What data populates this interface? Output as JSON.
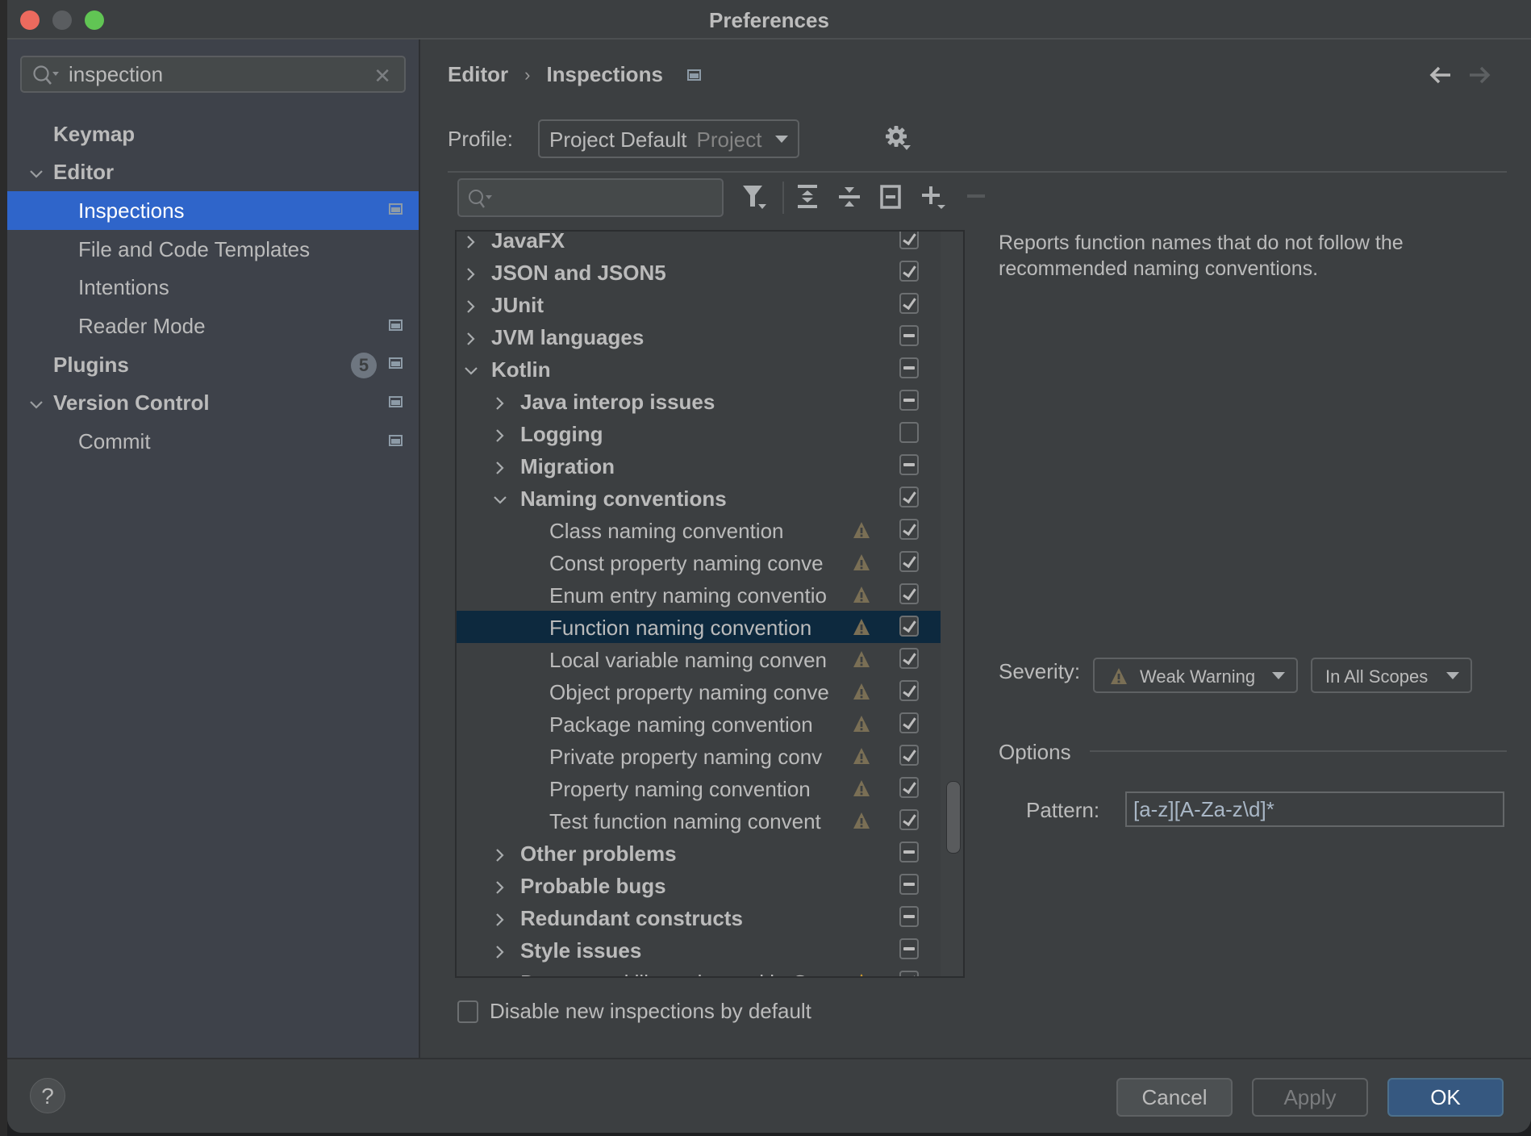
{
  "window": {
    "title": "Preferences"
  },
  "sidebar": {
    "search_value": "inspection",
    "items": [
      {
        "label": "Keymap",
        "level": 0,
        "bold": true,
        "expander": "none",
        "selected": false,
        "project_icon": false
      },
      {
        "label": "Editor",
        "level": 0,
        "bold": true,
        "expander": "expanded",
        "selected": false,
        "project_icon": false
      },
      {
        "label": "Inspections",
        "level": 1,
        "bold": false,
        "expander": "none",
        "selected": true,
        "project_icon": true
      },
      {
        "label": "File and Code Templates",
        "level": 1,
        "bold": false,
        "expander": "none",
        "selected": false,
        "project_icon": false
      },
      {
        "label": "Intentions",
        "level": 1,
        "bold": false,
        "expander": "none",
        "selected": false,
        "project_icon": false
      },
      {
        "label": "Reader Mode",
        "level": 1,
        "bold": false,
        "expander": "none",
        "selected": false,
        "project_icon": true
      },
      {
        "label": "Plugins",
        "level": 0,
        "bold": true,
        "expander": "none",
        "selected": false,
        "project_icon": true,
        "badge": "5"
      },
      {
        "label": "Version Control",
        "level": 0,
        "bold": true,
        "expander": "expanded",
        "selected": false,
        "project_icon": true
      },
      {
        "label": "Commit",
        "level": 1,
        "bold": false,
        "expander": "none",
        "selected": false,
        "project_icon": true
      }
    ]
  },
  "header": {
    "breadcrumb": [
      "Editor",
      "Inspections"
    ],
    "back_icon": "arrow-left-icon",
    "forward_icon": "arrow-right-icon"
  },
  "profile": {
    "label": "Profile:",
    "value": "Project Default",
    "scope": "Project"
  },
  "tree": {
    "search_value": "",
    "rows": [
      {
        "label": "JavaFX",
        "level": 0,
        "bold": true,
        "expander": "collapsed",
        "state": "checked",
        "warning": false
      },
      {
        "label": "JSON and JSON5",
        "level": 0,
        "bold": true,
        "expander": "collapsed",
        "state": "checked",
        "warning": false
      },
      {
        "label": "JUnit",
        "level": 0,
        "bold": true,
        "expander": "collapsed",
        "state": "checked",
        "warning": false
      },
      {
        "label": "JVM languages",
        "level": 0,
        "bold": true,
        "expander": "collapsed",
        "state": "partial",
        "warning": false
      },
      {
        "label": "Kotlin",
        "level": 0,
        "bold": true,
        "expander": "expanded",
        "state": "partial",
        "warning": false
      },
      {
        "label": "Java interop issues",
        "level": 1,
        "bold": true,
        "expander": "collapsed",
        "state": "partial",
        "warning": false
      },
      {
        "label": "Logging",
        "level": 1,
        "bold": true,
        "expander": "collapsed",
        "state": "unchecked",
        "warning": false
      },
      {
        "label": "Migration",
        "level": 1,
        "bold": true,
        "expander": "collapsed",
        "state": "partial",
        "warning": false
      },
      {
        "label": "Naming conventions",
        "level": 1,
        "bold": true,
        "expander": "expanded",
        "state": "checked",
        "warning": false
      },
      {
        "label": "Class naming convention",
        "level": 2,
        "bold": false,
        "expander": "none",
        "state": "checked",
        "warning": true
      },
      {
        "label": "Const property naming conve",
        "level": 2,
        "bold": false,
        "expander": "none",
        "state": "checked",
        "warning": true
      },
      {
        "label": "Enum entry naming conventio",
        "level": 2,
        "bold": false,
        "expander": "none",
        "state": "checked",
        "warning": true
      },
      {
        "label": "Function naming convention",
        "level": 2,
        "bold": false,
        "expander": "none",
        "state": "checked",
        "warning": true,
        "selected": true
      },
      {
        "label": "Local variable naming conven",
        "level": 2,
        "bold": false,
        "expander": "none",
        "state": "checked",
        "warning": true
      },
      {
        "label": "Object property naming conve",
        "level": 2,
        "bold": false,
        "expander": "none",
        "state": "checked",
        "warning": true
      },
      {
        "label": "Package naming convention",
        "level": 2,
        "bold": false,
        "expander": "none",
        "state": "checked",
        "warning": true
      },
      {
        "label": "Private property naming conv",
        "level": 2,
        "bold": false,
        "expander": "none",
        "state": "checked",
        "warning": true
      },
      {
        "label": "Property naming convention",
        "level": 2,
        "bold": false,
        "expander": "none",
        "state": "checked",
        "warning": true
      },
      {
        "label": "Test function naming convent",
        "level": 2,
        "bold": false,
        "expander": "none",
        "state": "checked",
        "warning": true
      },
      {
        "label": "Other problems",
        "level": 1,
        "bold": true,
        "expander": "collapsed",
        "state": "partial",
        "warning": false
      },
      {
        "label": "Probable bugs",
        "level": 1,
        "bold": true,
        "expander": "collapsed",
        "state": "partial",
        "warning": false
      },
      {
        "label": "Redundant constructs",
        "level": 1,
        "bold": true,
        "expander": "collapsed",
        "state": "partial",
        "warning": false
      },
      {
        "label": "Style issues",
        "level": 1,
        "bold": true,
        "expander": "collapsed",
        "state": "partial",
        "warning": false
      },
      {
        "label": "Deprecated library is used in Gra",
        "level": 1,
        "bold": false,
        "expander": "none",
        "state": "checked",
        "warning": true,
        "warning_color": "#d9a32e"
      }
    ]
  },
  "disable_new": {
    "label": "Disable new inspections by default",
    "checked": false
  },
  "details": {
    "description": "Reports function names that do not follow the recommended naming conventions.",
    "severity_label": "Severity:",
    "severity_value": "Weak Warning",
    "scope_value": "In All Scopes",
    "options_label": "Options",
    "pattern_label": "Pattern:",
    "pattern_value": "[a-z][A-Za-z\\d]*"
  },
  "footer": {
    "help_label": "?",
    "cancel_label": "Cancel",
    "apply_label": "Apply",
    "ok_label": "OK"
  },
  "colors": {
    "selection_active": "#2f65ca",
    "selection_tree": "#0d293e",
    "weak_warning": "#7a6f55",
    "ok_button": "#365880"
  }
}
